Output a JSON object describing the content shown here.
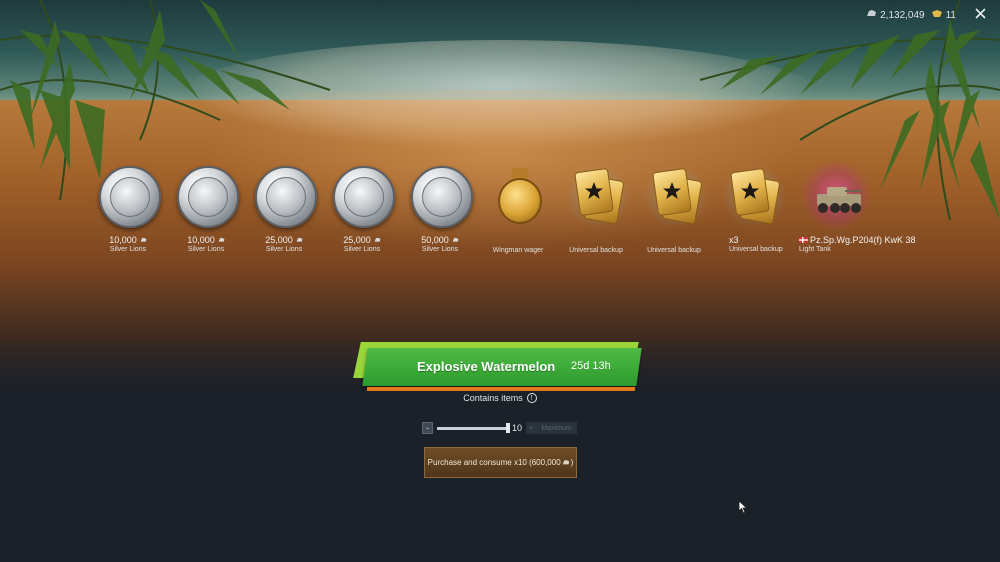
{
  "topbar": {
    "silver": "2,132,049",
    "gold": "11",
    "silver_icon": "silver-lion-icon",
    "gold_icon": "golden-eagle-icon",
    "close_icon": "close-icon"
  },
  "rewards": [
    {
      "amount": "10,000",
      "label": "Silver Lions",
      "icon": "silver-lion-coin"
    },
    {
      "amount": "10,000",
      "label": "Silver Lions",
      "icon": "silver-lion-coin"
    },
    {
      "amount": "25,000",
      "label": "Silver Lions",
      "icon": "silver-lion-coin"
    },
    {
      "amount": "25,000",
      "label": "Silver Lions",
      "icon": "silver-lion-coin"
    },
    {
      "amount": "50,000",
      "label": "Silver Lions",
      "icon": "silver-lion-coin"
    },
    {
      "amount": "",
      "label": "Wingman wager",
      "icon": "wager-medal"
    },
    {
      "amount": "",
      "label": "Universal backup",
      "icon": "backup-cards"
    },
    {
      "amount": "",
      "label": "Universal backup",
      "icon": "backup-cards"
    },
    {
      "amount": "x3",
      "label": "Universal backup",
      "icon": "backup-cards"
    },
    {
      "amount": "Pz.Sp.Wg.P204(f) KwK 38",
      "label": "Light Tank",
      "icon": "tank"
    }
  ],
  "banner": {
    "title": "Explosive Watermelon",
    "timer": "25d 13h"
  },
  "contains": {
    "text": "Contains items",
    "icon": "info-icon"
  },
  "quantity": {
    "minus": "-",
    "value": "10",
    "plus": "+",
    "max_label": "Maximum",
    "level": 1.0
  },
  "purchase": {
    "label": "Purchase and consume x10 (600,000"
  },
  "colors": {
    "banner_green": "#2d9a2f",
    "banner_accent": "#9ad63a",
    "banner_underline": "#e07a1c",
    "button_brown": "#5e4220"
  }
}
